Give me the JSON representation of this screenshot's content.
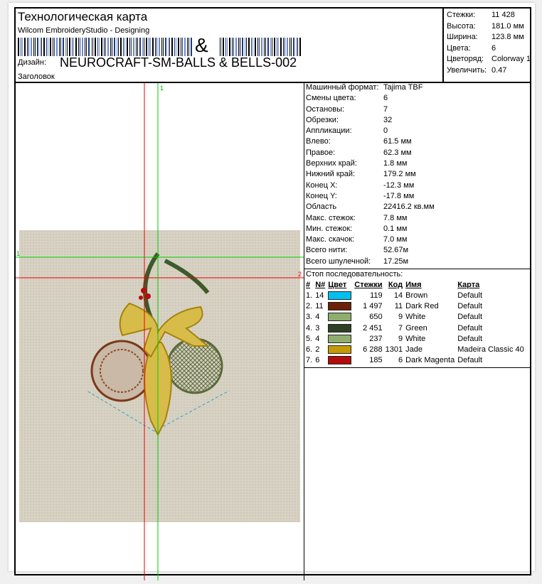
{
  "header": {
    "title": "Технологическая карта",
    "subtitle": "Wilcom EmbroideryStudio - Designing",
    "barcode_char": "&",
    "design_label": "Дизайн:",
    "design_name": "NEUROCRAFT-SM-BALLS & BELLS-002",
    "heading_label": "Заголовок"
  },
  "stats": [
    {
      "k": "Стежки:",
      "v": "11 428"
    },
    {
      "k": "Высота:",
      "v": "181.0 мм"
    },
    {
      "k": "Ширина:",
      "v": "123.8 мм"
    },
    {
      "k": "Цвета:",
      "v": "6"
    },
    {
      "k": "Цветоряд:",
      "v": "Colorway 1"
    },
    {
      "k": "Увеличить:",
      "v": "0.47"
    }
  ],
  "info": [
    {
      "k": "Машинный формат:",
      "v": "Tajima TBF"
    },
    {
      "k": "Смены цвета:",
      "v": "6"
    },
    {
      "k": "Остановы:",
      "v": "7"
    },
    {
      "k": "Обрезки:",
      "v": "32"
    },
    {
      "k": "Аппликации:",
      "v": "0"
    },
    {
      "k": "Влево:",
      "v": "61.5 мм"
    },
    {
      "k": "Правое:",
      "v": "62.3 мм"
    },
    {
      "k": "Верхних край:",
      "v": "1.8 мм"
    },
    {
      "k": "Нижний край:",
      "v": "179.2 мм"
    },
    {
      "k": "Конец X:",
      "v": "-12.3 мм"
    },
    {
      "k": "Конец Y:",
      "v": "-17.8 мм"
    },
    {
      "k": "Область",
      "v": "22416.2 кв.мм"
    },
    {
      "k": "Макс. стежок:",
      "v": "7.8 мм"
    },
    {
      "k": "Мин. стежок:",
      "v": "0.1 мм"
    },
    {
      "k": "Макс. скачок:",
      "v": "7.0 мм"
    },
    {
      "k": "Всего нити:",
      "v": "52.67м"
    },
    {
      "k": "Всего шпулечной:",
      "v": "17.25м"
    }
  ],
  "stop": {
    "title": "Стоп последовательность:",
    "columns": [
      "#",
      "N#",
      "Цвет",
      "Стежки",
      "Код",
      "Имя",
      "Карта"
    ],
    "rows": [
      {
        "i": "1.",
        "n": "14",
        "color": "#00c0f0",
        "st": "119",
        "code": "14",
        "name": "Brown",
        "map": "Default"
      },
      {
        "i": "2.",
        "n": "11",
        "color": "#6b2008",
        "st": "1 497",
        "code": "11",
        "name": "Dark Red",
        "map": "Default"
      },
      {
        "i": "3.",
        "n": "4",
        "color": "#8fae6e",
        "st": "650",
        "code": "9",
        "name": "White",
        "map": "Default"
      },
      {
        "i": "4.",
        "n": "3",
        "color": "#2f4024",
        "st": "2 451",
        "code": "7",
        "name": "Green",
        "map": "Default"
      },
      {
        "i": "5.",
        "n": "4",
        "color": "#8fae6e",
        "st": "237",
        "code": "9",
        "name": "White",
        "map": "Default"
      },
      {
        "i": "6.",
        "n": "2",
        "color": "#c49a06",
        "st": "6 288",
        "code": "1301",
        "name": "Jade",
        "map": "Madeira Classic 40"
      },
      {
        "i": "7.",
        "n": "6",
        "color": "#b20d0d",
        "st": "185",
        "code": "6",
        "name": "Dark Magenta",
        "map": "Default"
      }
    ]
  },
  "guides": {
    "v1": "1",
    "h1": "1",
    "h2": "2"
  }
}
